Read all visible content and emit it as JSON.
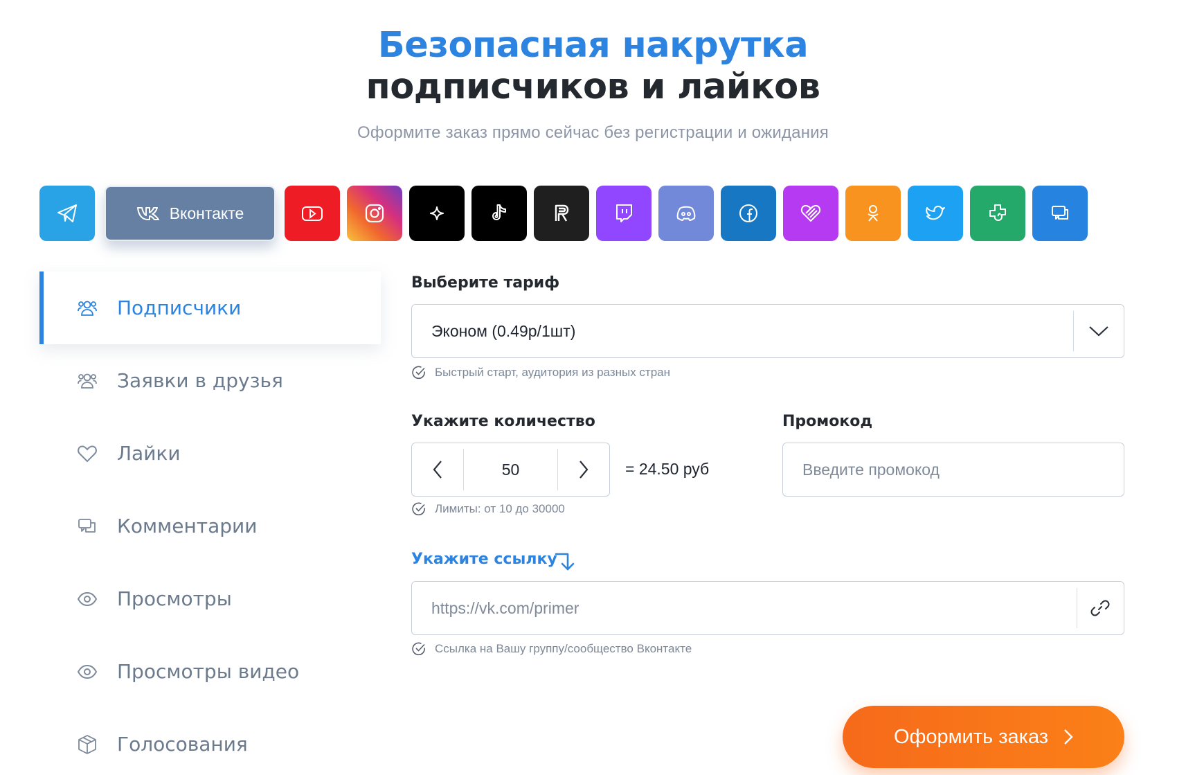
{
  "hero": {
    "title_line1": "Безопасная накрутка",
    "title_line2": "подписчиков и лайков",
    "subtitle": "Оформите заказ прямо сейчас без регистрации и ожидания"
  },
  "networks": {
    "active_label": "Вконтакте",
    "items": [
      {
        "name": "telegram",
        "icon": "telegram-icon",
        "color": "#2aa3e6"
      },
      {
        "name": "vkontakte",
        "icon": "vk-icon",
        "color": "#6680a3",
        "active": true
      },
      {
        "name": "youtube",
        "icon": "youtube-icon",
        "color": "#ee1c25"
      },
      {
        "name": "instagram",
        "icon": "instagram-icon",
        "color": "#d6307e"
      },
      {
        "name": "sparkle",
        "icon": "sparkle-icon",
        "color": "#000000"
      },
      {
        "name": "tiktok",
        "icon": "tiktok-icon",
        "color": "#000000"
      },
      {
        "name": "rutube",
        "icon": "rutube-icon",
        "color": "#1f1f1f"
      },
      {
        "name": "twitch",
        "icon": "twitch-icon",
        "color": "#9146ff"
      },
      {
        "name": "discord",
        "icon": "discord-icon",
        "color": "#7289da"
      },
      {
        "name": "facebook",
        "icon": "facebook-icon",
        "color": "#1877c2"
      },
      {
        "name": "likee",
        "icon": "likee-heart-icon",
        "color": "#b53af1"
      },
      {
        "name": "odnoklassniki",
        "icon": "ok-icon",
        "color": "#f7931e"
      },
      {
        "name": "twitter",
        "icon": "twitter-icon",
        "color": "#1da1f2"
      },
      {
        "name": "wizard",
        "icon": "puzzle-icon",
        "color": "#25a96b"
      },
      {
        "name": "chat",
        "icon": "chat-icon",
        "color": "#2683df"
      }
    ]
  },
  "sidebar": {
    "items": [
      {
        "label": "Подписчики",
        "icon": "users-icon",
        "active": true
      },
      {
        "label": "Заявки в друзья",
        "icon": "users-icon"
      },
      {
        "label": "Лайки",
        "icon": "heart-icon"
      },
      {
        "label": "Комментарии",
        "icon": "comments-icon"
      },
      {
        "label": "Просмотры",
        "icon": "eye-icon"
      },
      {
        "label": "Просмотры видео",
        "icon": "eye-icon"
      },
      {
        "label": "Голосования",
        "icon": "box-icon"
      }
    ]
  },
  "form": {
    "tariff_label": "Выберите тариф",
    "tariff_value": "Эконом (0.49р/1шт)",
    "tariff_hint": "Быстрый старт, аудитория из разных стран",
    "quantity_label": "Укажите количество",
    "quantity_value": "50",
    "total": "= 24.50 руб",
    "quantity_hint": "Лимиты: от 10 до 30000",
    "promo_label": "Промокод",
    "promo_placeholder": "Введите промокод",
    "link_label": "Укажите ссылку",
    "link_placeholder": "https://vk.com/primer",
    "link_hint": "Ссылка на Вашу группу/сообщество Вконтакте",
    "order_label": "Оформить заказ"
  },
  "colors": {
    "accent": "#2c83e0",
    "order": "#f66a1a",
    "text": "#24282f",
    "muted": "#6b7a8c"
  }
}
